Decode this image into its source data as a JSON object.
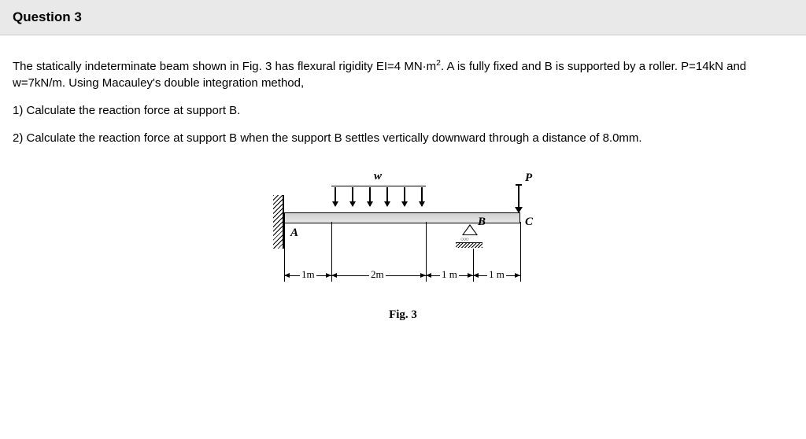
{
  "header": {
    "title": "Question 3"
  },
  "body": {
    "intro_part1": "The statically indeterminate beam shown in Fig. 3 has flexural rigidity EI=4 MN·m",
    "intro_sup": "2",
    "intro_part2": ". A is fully fixed and B is supported by a roller. P=14kN and w=7kN/m. Using Macauley's double integration method,",
    "q1": "1) Calculate the reaction force at support B.",
    "q2": "2) Calculate the reaction force at support B when the support B settles vertically downward through a distance of 8.0mm."
  },
  "fig": {
    "wlabel": "w",
    "plabel": "P",
    "A": "A",
    "B": "B",
    "C": "C",
    "d1": "1m",
    "d2": "2m",
    "d3": "1 m",
    "d4": "1 m",
    "caption": "Fig. 3"
  }
}
